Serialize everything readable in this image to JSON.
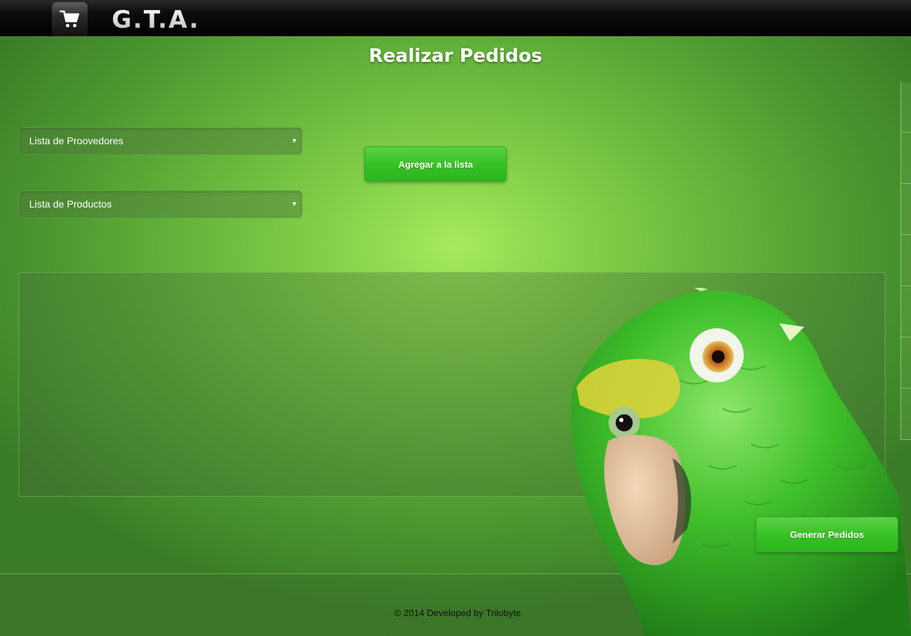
{
  "header": {
    "brand": "G.T.A.",
    "cart_icon": "shopping-cart-icon"
  },
  "page": {
    "title": "Realizar Pedidos"
  },
  "form": {
    "providers_select": {
      "selected": "Lista de Proovedores"
    },
    "products_select": {
      "selected": "Lista de Productos"
    },
    "add_button_label": "Agregar a la lista",
    "generate_button_label": "Generar Pedidos"
  },
  "footer": {
    "text": "© 2014 Developed by Trilobyte"
  },
  "colors": {
    "accent_green": "#35c024",
    "background_green": "#62b23a",
    "header_black": "#000000"
  }
}
